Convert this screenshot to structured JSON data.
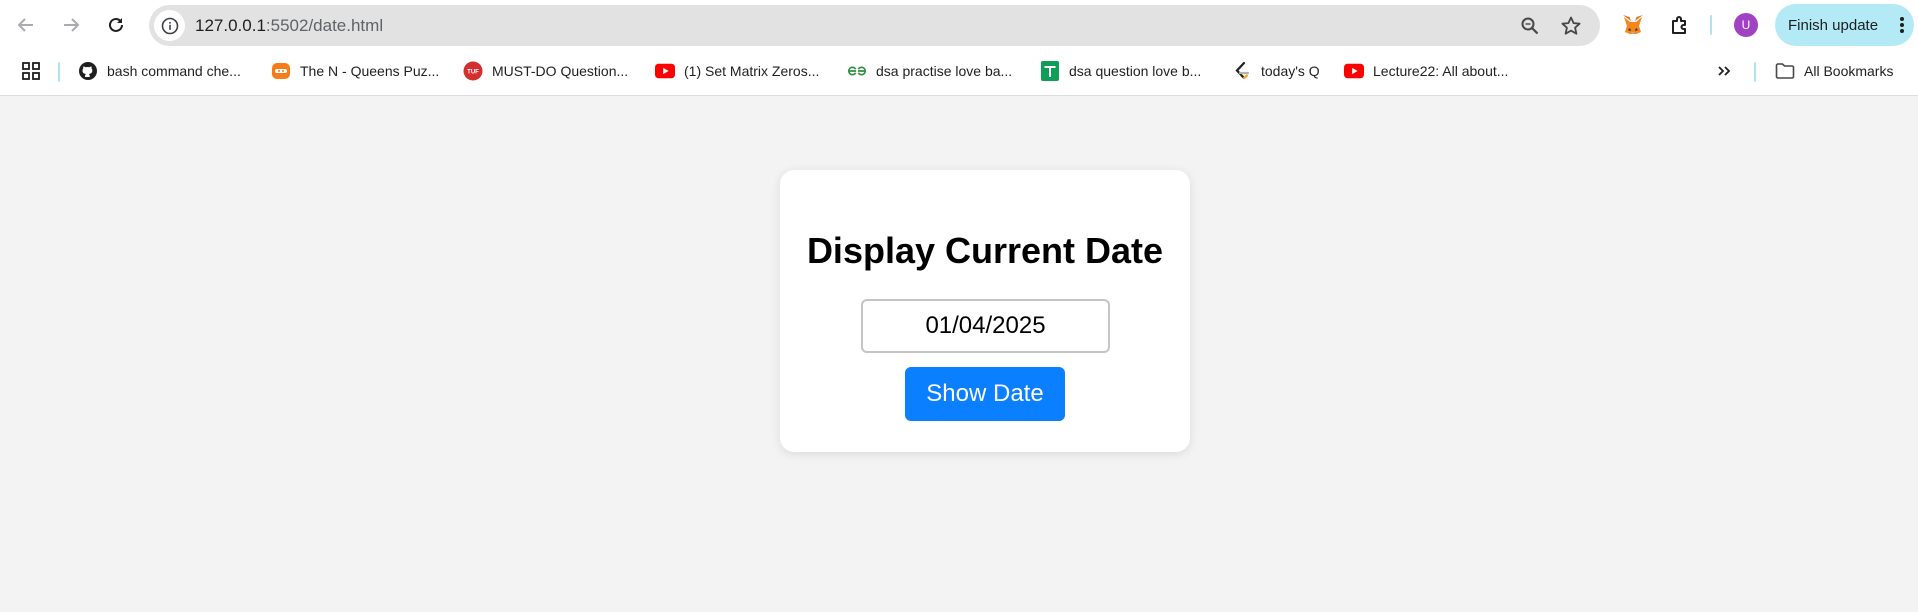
{
  "browser": {
    "url_host": "127.0.0.1",
    "url_rest": ":5502/date.html",
    "finish_update_label": "Finish update",
    "avatar_initial": "U",
    "colors": {
      "avatar": "#a142c4",
      "finish_update_bg": "#b3eaf6"
    }
  },
  "bookmarks": {
    "items": [
      {
        "label": "bash command che...",
        "icon": "github-icon"
      },
      {
        "label": "The N - Queens Puz...",
        "icon": "coding-ninjas-icon"
      },
      {
        "label": "MUST-DO Question...",
        "icon": "tuf-icon"
      },
      {
        "label": "(1) Set Matrix Zeros...",
        "icon": "youtube-icon"
      },
      {
        "label": "dsa practise love ba...",
        "icon": "gfg-icon"
      },
      {
        "label": "dsa question love b...",
        "icon": "google-sheets-icon"
      },
      {
        "label": "today's Q",
        "icon": "leetcode-icon"
      },
      {
        "label": "Lecture22: All about...",
        "icon": "youtube-icon"
      }
    ],
    "all_bookmarks_label": "All Bookmarks"
  },
  "page": {
    "heading": "Display Current Date",
    "date_value": "01/04/2025",
    "button_label": "Show Date",
    "colors": {
      "button": "#0a7fff",
      "background": "#f3f3f3"
    }
  }
}
